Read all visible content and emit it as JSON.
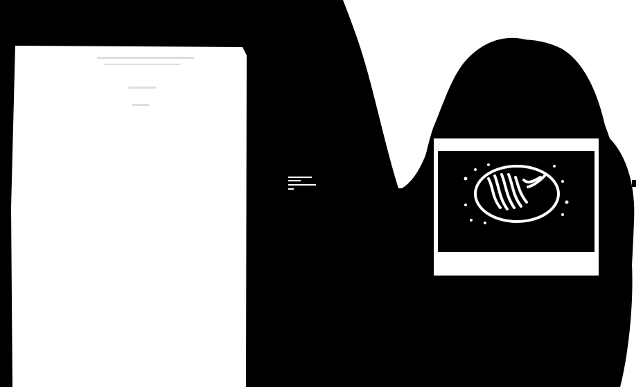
{
  "colors": {
    "background": "#000000",
    "foreground": "#ffffff"
  },
  "icons": {
    "left_panel": "blank-panel-icon",
    "artwork": "framed-artwork-icon"
  }
}
